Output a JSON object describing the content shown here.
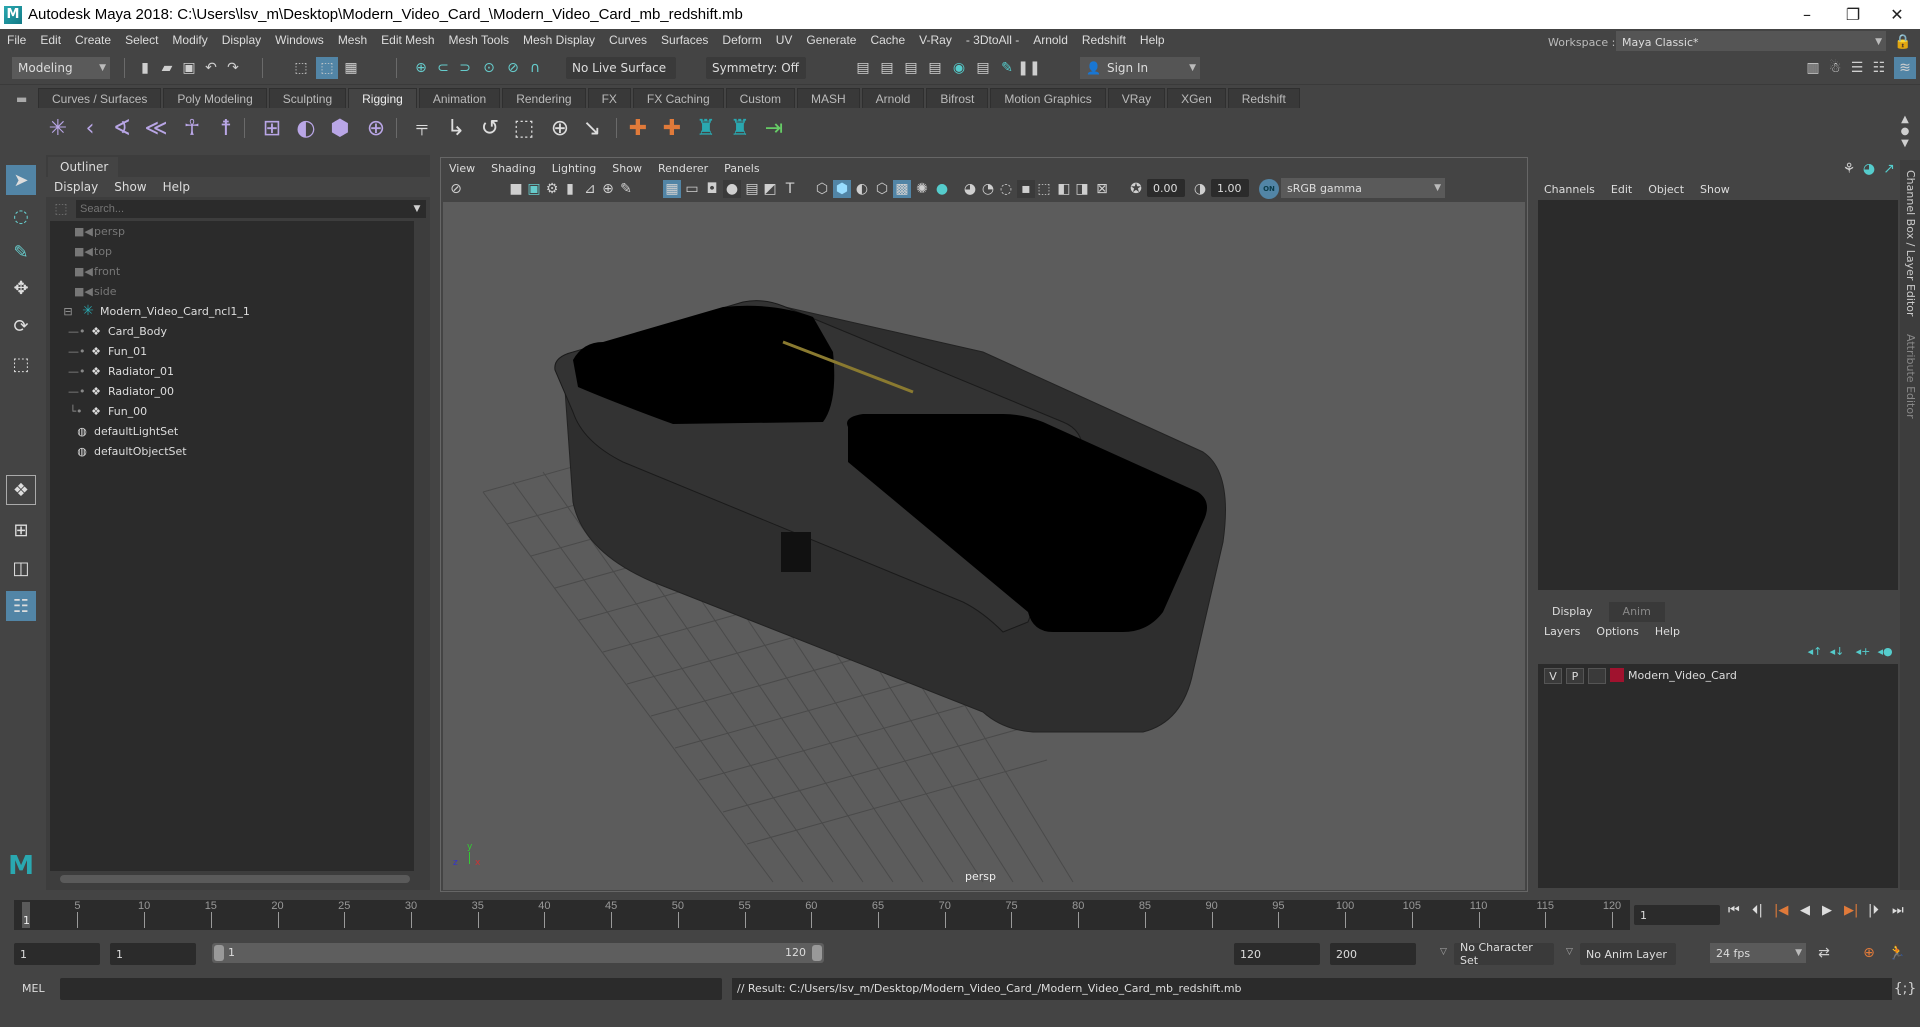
{
  "window": {
    "title": "Autodesk Maya 2018: C:\\Users\\lsv_m\\Desktop\\Modern_Video_Card_\\Modern_Video_Card_mb_redshift.mb",
    "logo": "M",
    "controls": {
      "minimize": "–",
      "restore": "❐",
      "close": "✕"
    }
  },
  "menubar": [
    "File",
    "Edit",
    "Create",
    "Select",
    "Modify",
    "Display",
    "Windows",
    "Mesh",
    "Edit Mesh",
    "Mesh Tools",
    "Mesh Display",
    "Curves",
    "Surfaces",
    "Deform",
    "UV",
    "Generate",
    "Cache",
    "V-Ray",
    "- 3DtoAll -",
    "Arnold",
    "Redshift",
    "Help"
  ],
  "workspace": {
    "label": "Workspace :",
    "value": "Maya Classic*"
  },
  "statusline": {
    "menuset": "Modeling",
    "live_surface": "No Live Surface",
    "symmetry": "Symmetry: Off",
    "sign_in": "Sign In"
  },
  "shelf": {
    "tabs": [
      "Curves / Surfaces",
      "Poly Modeling",
      "Sculpting",
      "Rigging",
      "Animation",
      "Rendering",
      "FX",
      "FX Caching",
      "Custom",
      "MASH",
      "Arnold",
      "Bifrost",
      "Motion Graphics",
      "VRay",
      "XGen",
      "Redshift"
    ],
    "active_tab": "Rigging"
  },
  "outliner": {
    "tab": "Outliner",
    "menu": [
      "Display",
      "Show",
      "Help"
    ],
    "search_placeholder": "Search...",
    "items": [
      {
        "label": "persp",
        "type": "camera",
        "dim": true
      },
      {
        "label": "top",
        "type": "camera",
        "dim": true
      },
      {
        "label": "front",
        "type": "camera",
        "dim": true
      },
      {
        "label": "side",
        "type": "camera",
        "dim": true
      },
      {
        "label": "Modern_Video_Card_ncl1_1",
        "type": "group",
        "expanded": true
      },
      {
        "label": "Card_Body",
        "type": "mesh",
        "child": true
      },
      {
        "label": "Fun_01",
        "type": "mesh",
        "child": true
      },
      {
        "label": "Radiator_01",
        "type": "mesh",
        "child": true
      },
      {
        "label": "Radiator_00",
        "type": "mesh",
        "child": true
      },
      {
        "label": "Fun_00",
        "type": "mesh",
        "child": true
      },
      {
        "label": "defaultLightSet",
        "type": "set"
      },
      {
        "label": "defaultObjectSet",
        "type": "set"
      }
    ]
  },
  "viewport": {
    "menu": [
      "View",
      "Shading",
      "Lighting",
      "Show",
      "Renderer",
      "Panels"
    ],
    "exposure": "0.00",
    "gamma": "1.00",
    "color_mgmt_badge": "ON",
    "color_space": "sRGB gamma",
    "camera_label": "persp",
    "axis": {
      "x": "x",
      "y": "y",
      "z": "z"
    }
  },
  "channelbox": {
    "menu": [
      "Channels",
      "Edit",
      "Object",
      "Show"
    ]
  },
  "layer_editor": {
    "tabs": [
      "Display",
      "Anim"
    ],
    "active_tab": "Display",
    "menu": [
      "Layers",
      "Options",
      "Help"
    ],
    "layers": [
      {
        "v": "V",
        "p": "P",
        "name": "Modern_Video_Card",
        "color": "#a0122e"
      }
    ]
  },
  "side_tabs": [
    "Channel Box / Layer Editor",
    "Attribute Editor"
  ],
  "timeline": {
    "start": 1,
    "end": 120,
    "labels": [
      5,
      10,
      15,
      20,
      25,
      30,
      35,
      40,
      45,
      50,
      55,
      60,
      65,
      70,
      75,
      80,
      85,
      90,
      95,
      100,
      105,
      110,
      115,
      120
    ],
    "current_frame": "1",
    "current_marker": "1"
  },
  "range": {
    "start_time": "1",
    "playback_start": "1",
    "range_start_label": "1",
    "range_end_label": "120",
    "playback_end": "120",
    "end_time": "200",
    "character_set": "No Character Set",
    "anim_layer": "No Anim Layer",
    "fps": "24 fps"
  },
  "commandline": {
    "label": "MEL",
    "result": "// Result: C:/Users/lsv_m/Desktop/Modern_Video_Card_/Modern_Video_Card_mb_redshift.mb"
  },
  "colors": {
    "accent": "#5285a6",
    "maya_teal": "#2aa8b0",
    "layer_color": "#a0122e",
    "timeline_marker": "#e07a3a"
  }
}
